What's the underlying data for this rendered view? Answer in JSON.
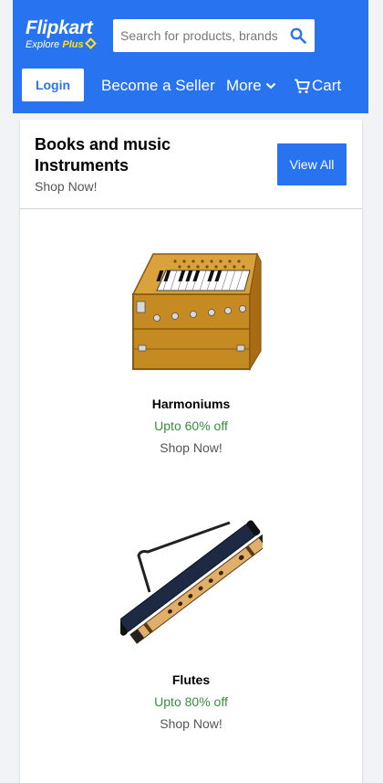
{
  "header": {
    "logo": "Flipkart",
    "tagline_prefix": "Explore",
    "tagline_plus": "Plus",
    "search_placeholder": "Search for products, brands and more",
    "login_label": "Login",
    "nav": {
      "seller": "Become a Seller",
      "more": "More",
      "cart": "Cart"
    }
  },
  "section": {
    "title": "Books and music Instruments",
    "subtitle": "Shop Now!",
    "view_all": "View All"
  },
  "products": [
    {
      "name": "Harmoniums",
      "offer": "Upto 60% off",
      "cta": "Shop Now!",
      "icon": "harmonium-image"
    },
    {
      "name": "Flutes",
      "offer": "Upto 80% off",
      "cta": "Shop Now!",
      "icon": "flute-image"
    }
  ],
  "colors": {
    "brand_blue": "#2874f0",
    "plus_yellow": "#ffe11b",
    "offer_green": "#388e3c"
  }
}
